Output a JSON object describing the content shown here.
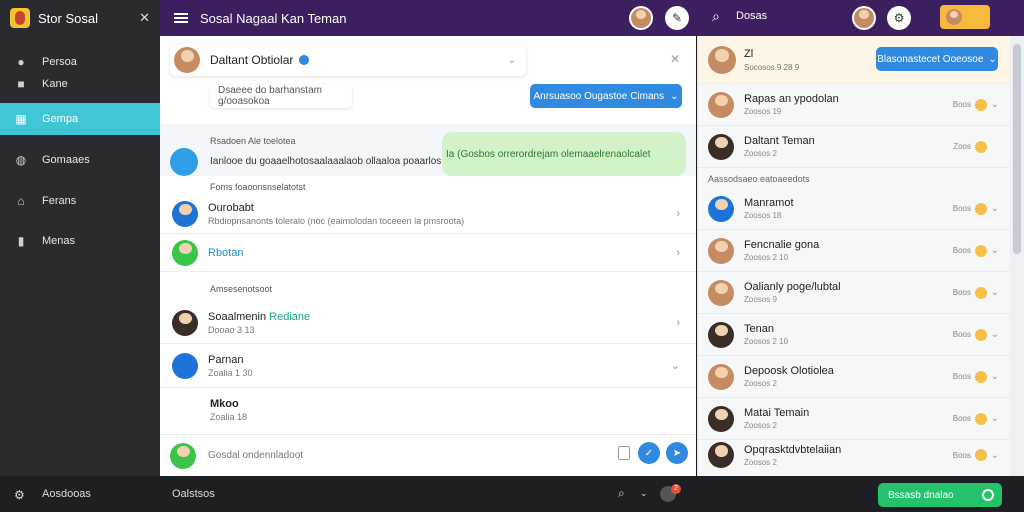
{
  "app": {
    "title": "Stor Sosal",
    "window_title": "Sosal Nagaal Kan Teman"
  },
  "topbar": {
    "close_glyph": "✕",
    "right_label": "Dosas"
  },
  "sidebar": {
    "items": [
      {
        "label": "Persoa",
        "icon": "person-icon",
        "glyph": "●"
      },
      {
        "label": "Kane",
        "icon": "square-icon",
        "glyph": "■"
      },
      {
        "label": "Gempa",
        "icon": "grid-icon",
        "glyph": "▦"
      },
      {
        "label": "Gomaaes",
        "icon": "chat-icon",
        "glyph": "◍"
      },
      {
        "label": "Ferans",
        "icon": "home-icon",
        "glyph": "⌂"
      },
      {
        "label": "Menas",
        "icon": "info-icon",
        "glyph": "▮"
      }
    ],
    "bottom_label": "Aosdooas"
  },
  "main": {
    "header_card": {
      "name": "Daltant Obtiolar"
    },
    "input_value": "Dsaeee do barhanstam g/ooasokoa",
    "action_button": "Anrsuasoo Ougastoe Cimans",
    "section1": "Rsadoen Ale toelotea",
    "notice": "Ianlooe du goaaelhotosaalaaalaob ollaaloa poaarlos",
    "green_bubble": "Ia (Gosbos orrerordrejam olemaaelrenaolcalet",
    "section2": "Foms foaoonsnselatotst",
    "rows": [
      {
        "title": "Ourobabt",
        "sub": "Rbdiopnsanonts toleralo (noc (eaimolodan toceeen la pmsroota)"
      },
      {
        "title": "Rbotan",
        "sub": ""
      }
    ],
    "section3": "Amsesenotsoot",
    "rows2": [
      {
        "title": "Soaalmenin",
        "title_green": "Rediane",
        "sub": "Dooao 3 13"
      },
      {
        "title": "Parnan",
        "sub": "Zoalia 1 30"
      },
      {
        "title_green": "Mkoo",
        "sub": "Zoalia 18"
      }
    ],
    "composer_placeholder": "Gosdal ondennladoot"
  },
  "right": {
    "head": {
      "name": "Zl",
      "time": "Socosos 9 28 9",
      "button": "Blasonastecet Ooeosoe"
    },
    "rows": [
      {
        "name": "Rapas an ypodolan",
        "status": "Zoosos 19",
        "meta": "Boos"
      },
      {
        "name": "Daltant Teman",
        "status": "Zoosos 2",
        "meta": "Zoos"
      }
    ],
    "section": "Aassodsaeo eatoaeedots",
    "rows2": [
      {
        "name": "Manramot",
        "status": "Zoosos 18",
        "meta": "Boos"
      },
      {
        "name": "Fencnalie gona",
        "status": "Zoosos 2 10",
        "meta": "Boos"
      },
      {
        "name": "Oalianly poge/lubtal",
        "status": "Zoosos 9",
        "meta": "Boos"
      },
      {
        "name": "Tenan",
        "status": "Zoosos 2 10",
        "meta": "Boos"
      },
      {
        "name": "Depoosk Olotiolea",
        "status": "Zoosos 2",
        "meta": "Boos"
      },
      {
        "name": "Matai Temain",
        "status": "Zoosos 2",
        "meta": "Boos"
      },
      {
        "name": "Opqrasktdvbtelaiian",
        "status": "Zoosos 2",
        "meta": "Boos"
      }
    ]
  },
  "bottom": {
    "center_label": "Oalstsos",
    "badge": "2",
    "green_button": "Bssasb dnalao"
  }
}
